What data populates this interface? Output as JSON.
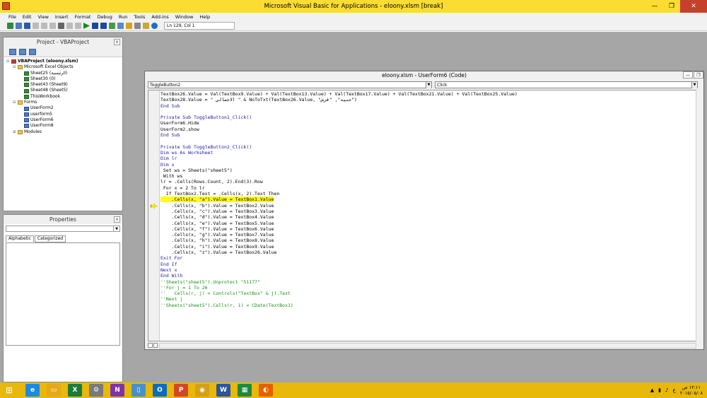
{
  "window": {
    "title": "Microsoft Visual Basic for Applications - eloony.xlsm [break]",
    "min": "—",
    "max": "❐",
    "close": "✕"
  },
  "menu": [
    "File",
    "Edit",
    "View",
    "Insert",
    "Format",
    "Debug",
    "Run",
    "Tools",
    "Add-Ins",
    "Window",
    "Help"
  ],
  "toolbar": {
    "position": "Ln 129, Col 1"
  },
  "project": {
    "title": "Project - VBAProject",
    "tree": [
      {
        "level": 0,
        "type": "proj",
        "label": "VBAProject (eloony.xlsm)",
        "twist": "⊟"
      },
      {
        "level": 1,
        "type": "folder",
        "label": "Microsoft Excel Objects",
        "twist": "⊟"
      },
      {
        "level": 2,
        "type": "sheet",
        "label": "Sheet25 (الرئيسية)",
        "twist": ""
      },
      {
        "level": 2,
        "type": "sheet",
        "label": "Sheet30 (0)",
        "twist": ""
      },
      {
        "level": 2,
        "type": "sheet",
        "label": "Sheet43 (Sheet9)",
        "twist": ""
      },
      {
        "level": 2,
        "type": "sheet",
        "label": "Sheet48 (Sheet5)",
        "twist": ""
      },
      {
        "level": 2,
        "type": "sheet",
        "label": "ThisWorkbook",
        "twist": ""
      },
      {
        "level": 1,
        "type": "folder",
        "label": "Forms",
        "twist": "⊟"
      },
      {
        "level": 2,
        "type": "form",
        "label": "UserForm2",
        "twist": ""
      },
      {
        "level": 2,
        "type": "form",
        "label": "userform5",
        "twist": ""
      },
      {
        "level": 2,
        "type": "form",
        "label": "UserForm6",
        "twist": ""
      },
      {
        "level": 2,
        "type": "form",
        "label": "UserForm8",
        "twist": ""
      },
      {
        "level": 1,
        "type": "folder",
        "label": "Modules",
        "twist": "⊞"
      }
    ]
  },
  "properties": {
    "title": "Properties",
    "tabs": [
      "Alphabetic",
      "Categorized"
    ]
  },
  "code": {
    "title": "eloony.xlsm - UserForm6 (Code)",
    "object": "ToggleButton2",
    "procedure": "Click",
    "lines": [
      {
        "t": "TextBox26.Value = Val(TextBox9.Value) + Val(TextBox13.Value) + Val(TextBox17.Value) + Val(TextBox21.Value) + Val(TextBox25.Value)",
        "c": ""
      },
      {
        "t": "TextBox28.Value = \" الاجمالي \" & NoToTxt(TextBox26.Value, \"جنيه\", \"قرش\")",
        "c": ""
      },
      {
        "t": "End Sub",
        "c": "kw"
      },
      {
        "t": "",
        "c": ""
      },
      {
        "t": "Private Sub ToggleButton1_Click()",
        "c": "kw"
      },
      {
        "t": "UserForm6.Hide",
        "c": ""
      },
      {
        "t": "UserForm2.show",
        "c": ""
      },
      {
        "t": "End Sub",
        "c": "kw"
      },
      {
        "t": "",
        "c": ""
      },
      {
        "t": "Private Sub ToggleButton2_Click()",
        "c": "kw"
      },
      {
        "t": "Dim ws As Worksheet",
        "c": "kw"
      },
      {
        "t": "Dim lr",
        "c": "kw"
      },
      {
        "t": "Dim x",
        "c": "kw"
      },
      {
        "t": " Set ws = Sheets(\"sheet5\")",
        "c": ""
      },
      {
        "t": " With ws",
        "c": ""
      },
      {
        "t": "lr = .Cells(Rows.Count, 2).End(3).Row",
        "c": ""
      },
      {
        "t": " For x = 2 To lr",
        "c": ""
      },
      {
        "t": "  If TextBox2.Text = .Cells(x, 2).Text Then",
        "c": ""
      },
      {
        "t": "    .Cells(x, \"a\").Value = TextBox1.Value",
        "c": "hl"
      },
      {
        "t": "    .Cells(x, \"b\").Value = TextBox2.Value",
        "c": ""
      },
      {
        "t": "    .Cells(x, \"c\").Value = TextBox3.Value",
        "c": ""
      },
      {
        "t": "    .Cells(x, \"d\").Value = TextBox4.Value",
        "c": ""
      },
      {
        "t": "    .Cells(x, \"e\").Value = TextBox5.Value",
        "c": ""
      },
      {
        "t": "    .Cells(x, \"f\").Value = TextBox6.Value",
        "c": ""
      },
      {
        "t": "    .Cells(x, \"g\").Value = TextBox7.Value",
        "c": ""
      },
      {
        "t": "    .Cells(x, \"h\").Value = TextBox8.Value",
        "c": ""
      },
      {
        "t": "    .Cells(x, \"i\").Value = TextBox9.Value",
        "c": ""
      },
      {
        "t": "    .Cells(x, \"z\").Value = TextBox26.Value",
        "c": ""
      },
      {
        "t": "Exit For",
        "c": "kw"
      },
      {
        "t": "End If",
        "c": "kw"
      },
      {
        "t": "Next x",
        "c": "kw"
      },
      {
        "t": "End With",
        "c": "kw"
      },
      {
        "t": "''Sheets(\"sheet5\").Unprotect \"51177\"",
        "c": "cm"
      },
      {
        "t": "''For j = 1 To 26",
        "c": "cm"
      },
      {
        "t": "''   Cells(r, j) = Controls(\"TextBox\" & j).Text",
        "c": "cm"
      },
      {
        "t": "''Next j",
        "c": "cm"
      },
      {
        "t": "''Sheets(\"sheet5\").Cells(r, 1) = CDate(TextBox1)",
        "c": "cm"
      }
    ]
  },
  "taskbar": {
    "start": "⊞",
    "apps": [
      {
        "name": "ie-icon",
        "glyph": "e",
        "color": "#1e88e5"
      },
      {
        "name": "explorer-icon",
        "glyph": "▭",
        "color": "#e6a817"
      },
      {
        "name": "excel-icon",
        "glyph": "X",
        "color": "#1d7a3c"
      },
      {
        "name": "vba-icon",
        "glyph": "⚙",
        "color": "#7a7a7a"
      },
      {
        "name": "onenote-icon",
        "glyph": "N",
        "color": "#8033a8"
      },
      {
        "name": "file-icon",
        "glyph": "▯",
        "color": "#4a90c8"
      },
      {
        "name": "outlook-icon",
        "glyph": "O",
        "color": "#0f6cbd"
      },
      {
        "name": "powerpoint-icon",
        "glyph": "P",
        "color": "#d24726"
      },
      {
        "name": "chrome-icon",
        "glyph": "◉",
        "color": "#d4a017"
      },
      {
        "name": "word-icon",
        "glyph": "W",
        "color": "#2b579a"
      },
      {
        "name": "store-icon",
        "glyph": "▦",
        "color": "#1e8a3c"
      },
      {
        "name": "firefox-icon",
        "glyph": "◐",
        "color": "#e66000"
      }
    ],
    "time": "١٢:١١ ص",
    "date": "٢٠١٥/٠٥/٠٨",
    "lang": "ع"
  }
}
